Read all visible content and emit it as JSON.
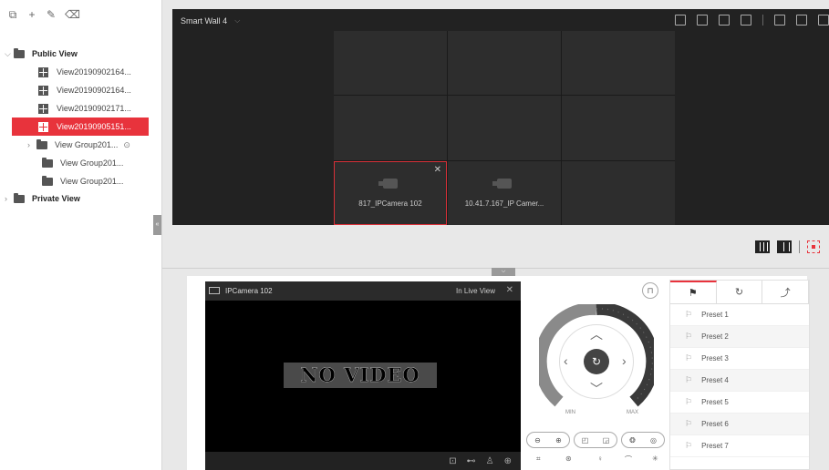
{
  "left_toolbar": {
    "icons": [
      "add-view-icon",
      "plus-icon",
      "edit-icon",
      "delete-icon"
    ],
    "glyphs": [
      "⧉",
      "+",
      "✎",
      "🗑"
    ]
  },
  "tree": {
    "public_view": "Public View",
    "items": [
      {
        "label": "View20190902164..."
      },
      {
        "label": "View20190902164..."
      },
      {
        "label": "View20190902171..."
      },
      {
        "label": "View20190905151..."
      }
    ],
    "groups": [
      {
        "label": "View Group201..."
      },
      {
        "label": "View Group201..."
      },
      {
        "label": "View Group201..."
      }
    ],
    "private_view": "Private View"
  },
  "wall": {
    "title": "Smart Wall 4",
    "cells": [
      {
        "label": "817_IPCamera 102"
      },
      {
        "label": "10.41.7.167_IP Camer..."
      }
    ]
  },
  "live_view": {
    "camera_name": "IPCamera 102",
    "status": "In Live View",
    "no_video": "NO VIDEO"
  },
  "ptz": {
    "min_label": "MIN",
    "max_label": "MAX"
  },
  "presets": {
    "tabs": [
      "preset-tab",
      "patrol-tab",
      "pattern-tab"
    ],
    "items": [
      "Preset 1",
      "Preset 2",
      "Preset 3",
      "Preset 4",
      "Preset 5",
      "Preset 6",
      "Preset 7"
    ]
  },
  "colors": {
    "accent": "#e8333c",
    "wall_bg": "#222222"
  }
}
